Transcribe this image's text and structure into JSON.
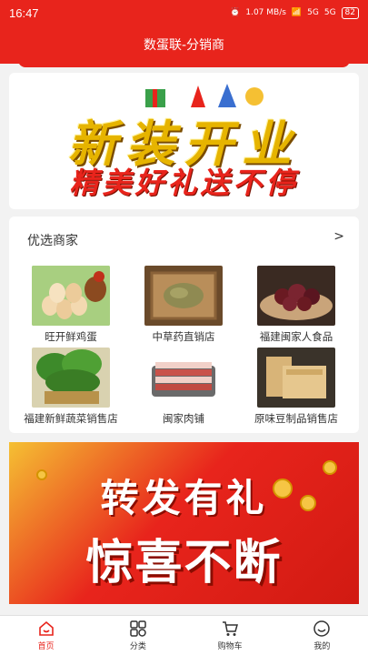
{
  "status_bar": {
    "time": "16:47",
    "network_speed": "1.07 MB/s",
    "signal1": "5G",
    "signal2": "5G",
    "battery": "82"
  },
  "header": {
    "title": "数蛋联-分销商"
  },
  "banner_top": {
    "line1": "新装开业",
    "line2": "精美好礼送不停"
  },
  "merchants_section": {
    "title": "优选商家",
    "more": ">",
    "items": [
      {
        "name": "旺开鲜鸡蛋",
        "image": "eggs-image"
      },
      {
        "name": "中草药直销店",
        "image": "herbs-image"
      },
      {
        "name": "福建闽家人食品",
        "image": "dried-fruit-image"
      },
      {
        "name": "福建新鲜蔬菜销售店",
        "image": "vegetables-image"
      },
      {
        "name": "闽家肉铺",
        "image": "pork-image"
      },
      {
        "name": "原味豆制品销售店",
        "image": "tofu-image"
      }
    ]
  },
  "banner_bottom": {
    "line1": "转发有礼",
    "line2": "惊喜不断"
  },
  "tabs": [
    {
      "label": "首页",
      "icon": "home-icon",
      "active": true
    },
    {
      "label": "分类",
      "icon": "category-icon",
      "active": false
    },
    {
      "label": "购物车",
      "icon": "cart-icon",
      "active": false
    },
    {
      "label": "我的",
      "icon": "profile-icon",
      "active": false
    }
  ],
  "colors": {
    "brand_red": "#e8241c",
    "gold": "#e6b400"
  }
}
